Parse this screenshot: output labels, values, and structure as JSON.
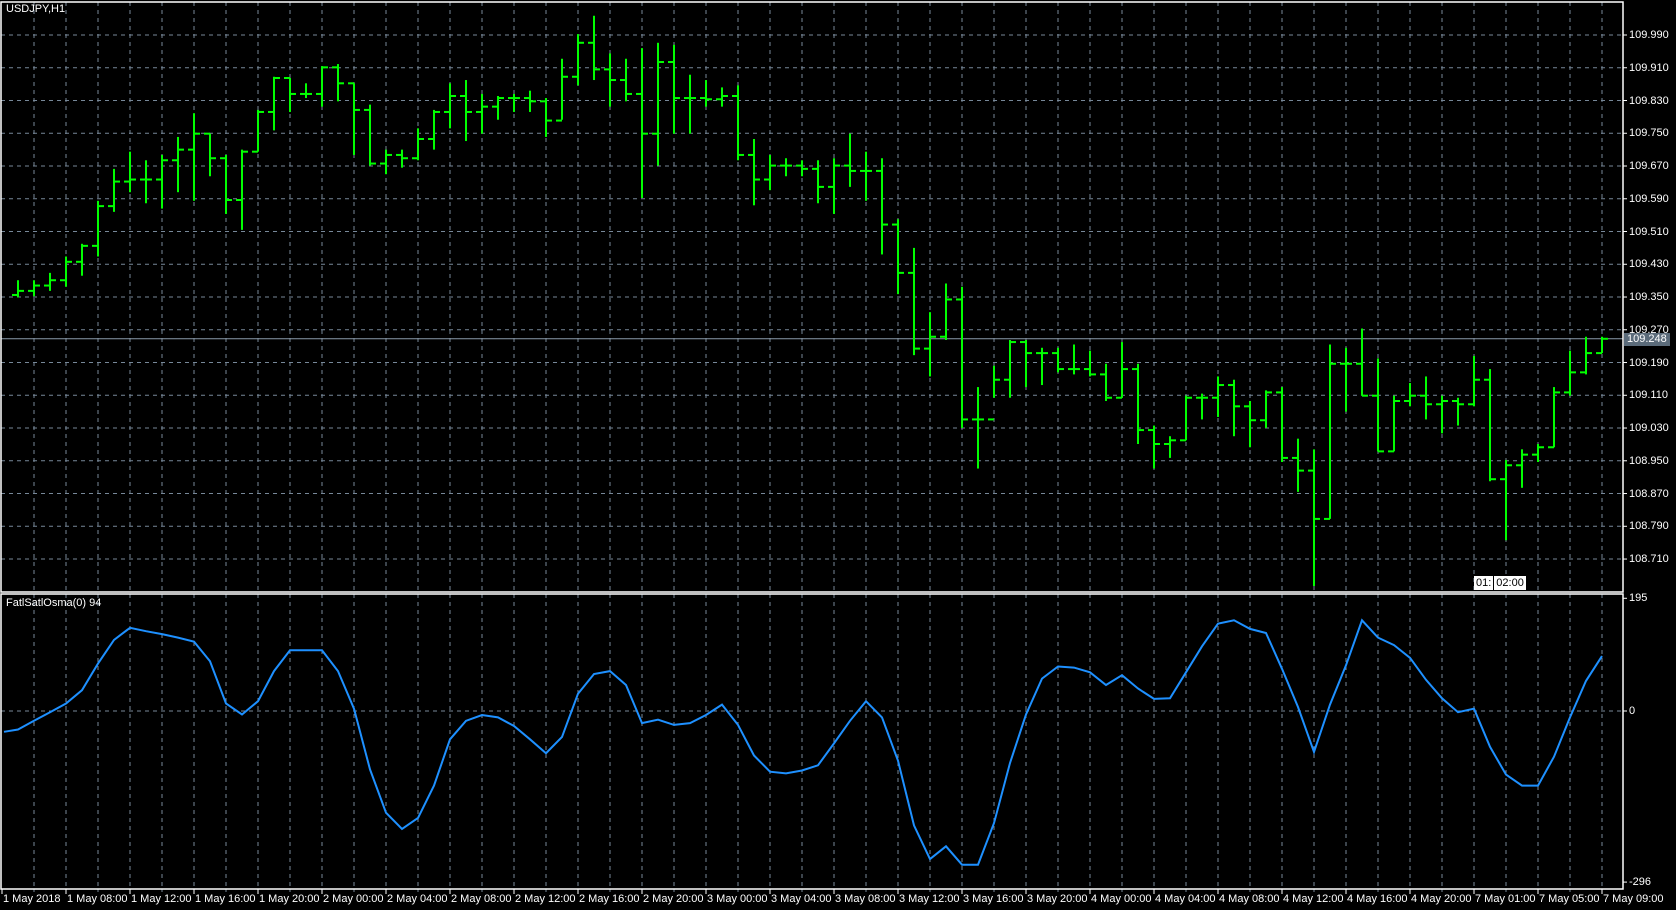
{
  "symbol_title": "USDJPY,H1",
  "indicator_title": "FatlSatlOsma(0) 94",
  "current_price": "109.248",
  "crosshair_labels": [
    "01:",
    "02:00"
  ],
  "colors": {
    "bars": "#00ff00",
    "indicator": "#1e90ff",
    "grid": "#778899",
    "frame": "#ffffff",
    "price_label_bg": "#5b6b7a"
  },
  "price_axis": [
    "109.990",
    "109.910",
    "109.830",
    "109.750",
    "109.670",
    "109.590",
    "109.510",
    "109.430",
    "109.350",
    "109.270",
    "109.190",
    "109.110",
    "109.030",
    "108.950",
    "108.870",
    "108.790",
    "108.710"
  ],
  "indicator_axis": {
    "max": "195",
    "zero": "0",
    "min": "-296"
  },
  "time_axis": [
    "1 May 2018",
    "1 May 08:00",
    "1 May 12:00",
    "1 May 16:00",
    "1 May 20:00",
    "2 May 00:00",
    "2 May 04:00",
    "2 May 08:00",
    "2 May 12:00",
    "2 May 16:00",
    "2 May 20:00",
    "3 May 00:00",
    "3 May 04:00",
    "3 May 08:00",
    "3 May 12:00",
    "3 May 16:00",
    "3 May 20:00",
    "4 May 00:00",
    "4 May 04:00",
    "4 May 08:00",
    "4 May 12:00",
    "4 May 16:00",
    "4 May 20:00",
    "7 May 01:00",
    "7 May 05:00",
    "7 May 09:00"
  ],
  "chart_data": {
    "type": "ohlc",
    "open_first": 109.355,
    "bars_hlc": [
      [
        109.391,
        109.349,
        109.365
      ],
      [
        109.391,
        109.352,
        109.378
      ],
      [
        109.409,
        109.365,
        109.391
      ],
      [
        109.449,
        109.375,
        109.436
      ],
      [
        109.48,
        109.402,
        109.475
      ],
      [
        109.585,
        109.449,
        109.572
      ],
      [
        109.663,
        109.558,
        109.632
      ],
      [
        109.705,
        109.606,
        109.637
      ],
      [
        109.684,
        109.579,
        109.637
      ],
      [
        109.697,
        109.566,
        109.684
      ],
      [
        109.741,
        109.606,
        109.71
      ],
      [
        109.799,
        109.585,
        109.749
      ],
      [
        109.749,
        109.645,
        109.689
      ],
      [
        109.697,
        109.553,
        109.587
      ],
      [
        109.71,
        109.514,
        109.705
      ],
      [
        109.807,
        109.705,
        109.802
      ],
      [
        109.888,
        109.757,
        109.885
      ],
      [
        109.885,
        109.802,
        109.846
      ],
      [
        109.872,
        109.836,
        109.846
      ],
      [
        109.914,
        109.815,
        109.911
      ],
      [
        109.919,
        109.828,
        109.872
      ],
      [
        109.872,
        109.697,
        109.807
      ],
      [
        109.82,
        109.671,
        109.676
      ],
      [
        109.71,
        109.65,
        109.697
      ],
      [
        109.71,
        109.666,
        109.689
      ],
      [
        109.762,
        109.684,
        109.736
      ],
      [
        109.807,
        109.71,
        109.802
      ],
      [
        109.872,
        109.762,
        109.841
      ],
      [
        109.88,
        109.731,
        109.802
      ],
      [
        109.846,
        109.749,
        109.815
      ],
      [
        109.841,
        109.783,
        109.836
      ],
      [
        109.846,
        109.802,
        109.836
      ],
      [
        109.854,
        109.802,
        109.828
      ],
      [
        109.836,
        109.741,
        109.781
      ],
      [
        109.932,
        109.783,
        109.888
      ],
      [
        109.992,
        109.867,
        109.971
      ],
      [
        110.037,
        109.88,
        109.906
      ],
      [
        109.945,
        109.815,
        109.88
      ],
      [
        109.932,
        109.828,
        109.846
      ],
      [
        109.958,
        109.592,
        109.749
      ],
      [
        109.971,
        109.671,
        109.924
      ],
      [
        109.966,
        109.749,
        109.836
      ],
      [
        109.893,
        109.749,
        109.836
      ],
      [
        109.88,
        109.815,
        109.833
      ],
      [
        109.862,
        109.815,
        109.841
      ],
      [
        109.867,
        109.684,
        109.697
      ],
      [
        109.736,
        109.574,
        109.637
      ],
      [
        109.697,
        109.611,
        109.671
      ],
      [
        109.689,
        109.645,
        109.671
      ],
      [
        109.684,
        109.645,
        109.663
      ],
      [
        109.684,
        109.579,
        109.619
      ],
      [
        109.689,
        109.553,
        109.671
      ],
      [
        109.749,
        109.619,
        109.658
      ],
      [
        109.705,
        109.585,
        109.658
      ],
      [
        109.689,
        109.454,
        109.527
      ],
      [
        109.54,
        109.357,
        109.409
      ],
      [
        109.47,
        109.208,
        109.224
      ],
      [
        109.313,
        109.156,
        109.253
      ],
      [
        109.383,
        109.245,
        109.344
      ],
      [
        109.375,
        109.03,
        109.051
      ],
      [
        109.13,
        108.931,
        109.051
      ],
      [
        109.182,
        109.104,
        109.148
      ],
      [
        109.245,
        109.104,
        109.24
      ],
      [
        109.245,
        109.13,
        109.213
      ],
      [
        109.226,
        109.135,
        109.213
      ],
      [
        109.226,
        109.166,
        109.174
      ],
      [
        109.234,
        109.161,
        109.174
      ],
      [
        109.219,
        109.156,
        109.161
      ],
      [
        109.187,
        109.096,
        109.104
      ],
      [
        109.24,
        109.104,
        109.174
      ],
      [
        109.187,
        108.991,
        109.025
      ],
      [
        109.036,
        108.931,
        108.991
      ],
      [
        109.01,
        108.957,
        109.0
      ],
      [
        109.109,
        109.0,
        109.104
      ],
      [
        109.114,
        109.051,
        109.104
      ],
      [
        109.156,
        109.057,
        109.135
      ],
      [
        109.148,
        109.01,
        109.083
      ],
      [
        109.096,
        108.983,
        109.049
      ],
      [
        109.122,
        109.03,
        109.117
      ],
      [
        109.13,
        108.947,
        108.957
      ],
      [
        109.004,
        108.874,
        108.926
      ],
      [
        108.978,
        108.644,
        108.808
      ],
      [
        109.234,
        108.808,
        109.187
      ],
      [
        109.226,
        109.07,
        109.187
      ],
      [
        109.273,
        109.109,
        109.109
      ],
      [
        109.2,
        108.973,
        108.973
      ],
      [
        109.109,
        108.973,
        109.096
      ],
      [
        109.14,
        109.083,
        109.109
      ],
      [
        109.156,
        109.051,
        109.088
      ],
      [
        109.109,
        109.017,
        109.096
      ],
      [
        109.104,
        109.036,
        109.088
      ],
      [
        109.206,
        109.083,
        109.148
      ],
      [
        109.174,
        108.9,
        108.905
      ],
      [
        108.952,
        108.756,
        108.939
      ],
      [
        108.978,
        108.884,
        108.965
      ],
      [
        108.991,
        108.947,
        108.983
      ],
      [
        109.13,
        108.983,
        109.117
      ],
      [
        109.219,
        109.109,
        109.166
      ],
      [
        109.253,
        109.161,
        109.213
      ],
      [
        109.253,
        109.213,
        109.248
      ]
    ],
    "price_range": [
      108.63,
      110.075
    ],
    "indicator": {
      "name": "FatlSatlOsma",
      "range": [
        -296,
        195
      ],
      "values": [
        -32,
        -17,
        -2,
        13,
        36,
        82,
        123,
        144,
        138,
        133,
        127,
        120,
        86,
        13,
        -6,
        17,
        69,
        105,
        105,
        105,
        69,
        4,
        -101,
        -176,
        -204,
        -185,
        -129,
        -49,
        -17,
        -7,
        -11,
        -26,
        -49,
        -73,
        -45,
        30,
        64,
        69,
        45,
        -21,
        -15,
        -24,
        -21,
        -7,
        11,
        -24,
        -77,
        -105,
        -108,
        -103,
        -94,
        -56,
        -17,
        17,
        -11,
        -86,
        -198,
        -256,
        -234,
        -266,
        -266,
        -194,
        -90,
        -6,
        56,
        77,
        75,
        67,
        45,
        62,
        39,
        21,
        22,
        67,
        112,
        151,
        157,
        142,
        135,
        73,
        7,
        -71,
        11,
        79,
        157,
        127,
        114,
        92,
        54,
        22,
        -2,
        4,
        -62,
        -110,
        -129,
        -129,
        -79,
        -11,
        52,
        95
      ]
    }
  }
}
